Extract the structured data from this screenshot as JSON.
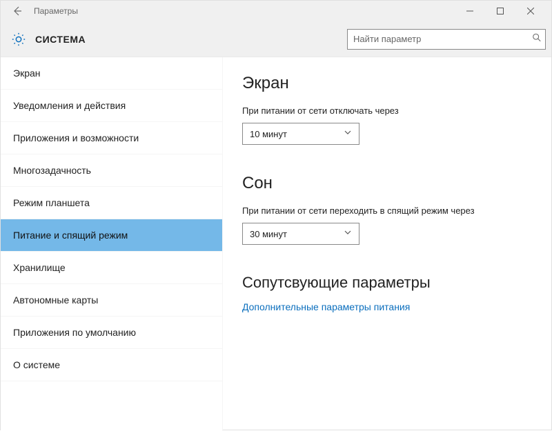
{
  "titlebar": {
    "title": "Параметры"
  },
  "header": {
    "section_title": "СИСТЕМА",
    "search_placeholder": "Найти параметр"
  },
  "sidebar": {
    "selected_index": 5,
    "items": [
      {
        "label": "Экран"
      },
      {
        "label": "Уведомления и действия"
      },
      {
        "label": "Приложения и возможности"
      },
      {
        "label": "Многозадачность"
      },
      {
        "label": "Режим планшета"
      },
      {
        "label": "Питание и спящий режим"
      },
      {
        "label": "Хранилище"
      },
      {
        "label": "Автономные карты"
      },
      {
        "label": "Приложения по умолчанию"
      },
      {
        "label": "О системе"
      }
    ]
  },
  "main": {
    "screen": {
      "heading": "Экран",
      "plugged_off_label": "При питании от сети отключать через",
      "plugged_off_value": "10 минут"
    },
    "sleep": {
      "heading": "Сон",
      "plugged_sleep_label": "При питании от сети переходить в спящий режим через",
      "plugged_sleep_value": "30 минут"
    },
    "related": {
      "heading": "Сопутсвующие параметры",
      "power_link": "Дополнительные параметры питания"
    }
  }
}
